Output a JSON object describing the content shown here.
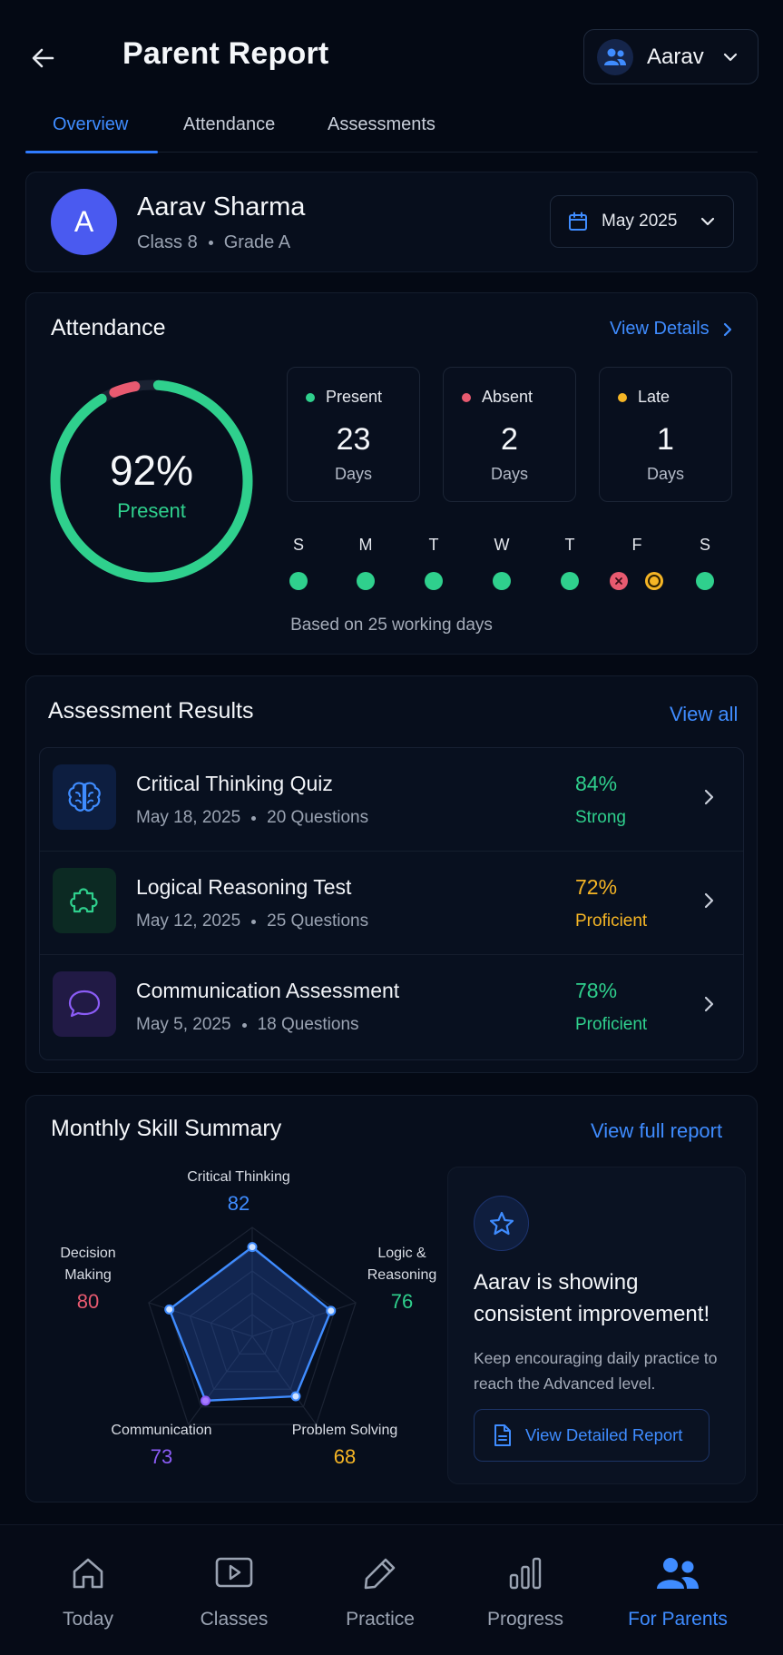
{
  "header": {
    "title": "Parent Report",
    "child_name": "Aarav"
  },
  "tabs": [
    {
      "label": "Overview",
      "active": true
    },
    {
      "label": "Attendance",
      "active": false
    },
    {
      "label": "Assessments",
      "active": false
    }
  ],
  "student": {
    "initial": "A",
    "name": "Aarav Sharma",
    "class": "Class 8",
    "grade": "Grade A",
    "month": "May 2025"
  },
  "attendance": {
    "title": "Attendance",
    "link": "View Details",
    "percent": "92%",
    "percent_label": "Present",
    "present_fraction": 0.92,
    "stats": [
      {
        "label": "Present",
        "value": "23",
        "unit": "Days",
        "color": "#2FD08D"
      },
      {
        "label": "Absent",
        "value": "2",
        "unit": "Days",
        "color": "#E85A70"
      },
      {
        "label": "Late",
        "value": "1",
        "unit": "Days",
        "color": "#F5B525"
      }
    ],
    "week_days": [
      "S",
      "M",
      "T",
      "W",
      "T",
      "F",
      "S"
    ],
    "note": "Based on 25 working days"
  },
  "assessments": {
    "title": "Assessment Results",
    "link": "View all",
    "items": [
      {
        "title": "Critical Thinking Quiz",
        "date": "May 18, 2025",
        "questions": "20 Questions",
        "score": "84%",
        "level": "Strong",
        "color": "#2FD08D",
        "icon": "brain-icon"
      },
      {
        "title": "Logical Reasoning Test",
        "date": "May 12, 2025",
        "questions": "25 Questions",
        "score": "72%",
        "level": "Proficient",
        "color": "#F5B525",
        "icon": "puzzle-icon"
      },
      {
        "title": "Communication Assessment",
        "date": "May 5, 2025",
        "questions": "18 Questions",
        "score": "78%",
        "level": "Proficient",
        "color": "#2FD08D",
        "icon": "chat-bubble-icon"
      }
    ]
  },
  "skills": {
    "title": "Monthly Skill Summary",
    "link": "View full report",
    "axes": [
      {
        "label": "Critical Thinking",
        "value": 82,
        "color": "#3F8CFF"
      },
      {
        "label": "Logic & Reasoning",
        "value": 76,
        "color": "#2FD08D"
      },
      {
        "label": "Problem Solving",
        "value": 68,
        "color": "#F5B525"
      },
      {
        "label": "Communication",
        "value": 73,
        "color": "#8B5CF6"
      },
      {
        "label": "Decision Making",
        "value": 80,
        "color": "#E85A70"
      }
    ],
    "insight_title": "Aarav is showing consistent improvement!",
    "insight_body": "Keep encouraging daily practice to reach the Advanced level.",
    "insight_button": "View Detailed Report"
  },
  "nav": [
    {
      "label": "Today",
      "icon": "home-icon",
      "active": false
    },
    {
      "label": "Classes",
      "icon": "play-icon",
      "active": false
    },
    {
      "label": "Practice",
      "icon": "pencil-icon",
      "active": false
    },
    {
      "label": "Progress",
      "icon": "bar-chart-icon",
      "active": false
    },
    {
      "label": "For Parents",
      "icon": "parents-icon",
      "active": true
    }
  ],
  "colors": {
    "accent": "#3F8CFF",
    "present": "#2FD08D",
    "absent": "#E85A70",
    "late": "#F5B525"
  }
}
